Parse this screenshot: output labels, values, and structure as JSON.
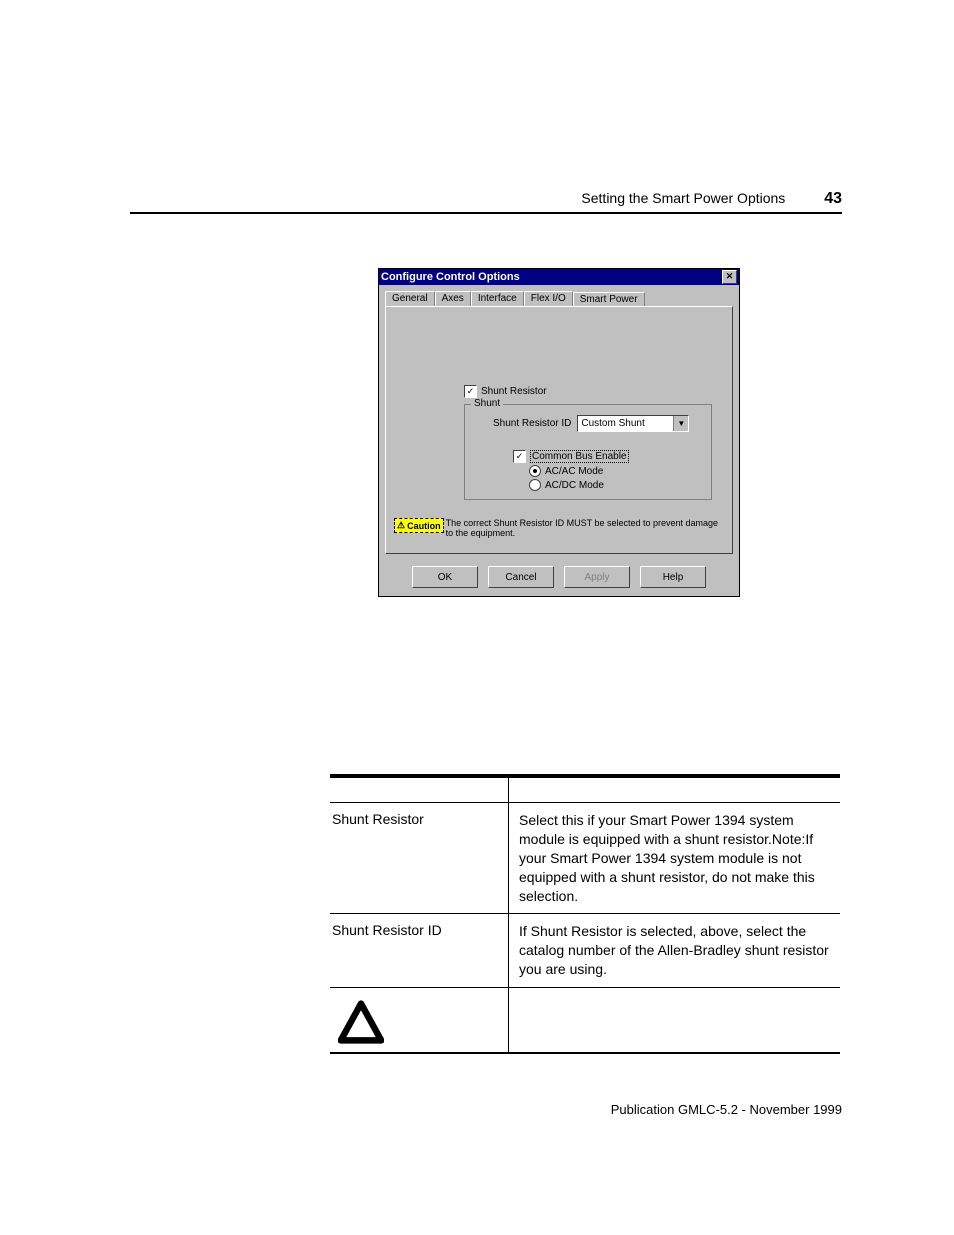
{
  "header": {
    "title": "Setting the Smart Power Options",
    "page_number": "43"
  },
  "footer": "Publication GMLC-5.2 - November 1999",
  "dialog": {
    "title": "Configure Control Options",
    "close_glyph": "✕",
    "tabs": {
      "general": "General",
      "axes": "Axes",
      "interface": "Interface",
      "flexio": "Flex I/O",
      "smart_power": "Smart Power"
    },
    "shunt_resistor_label": "Shunt Resistor",
    "shunt_group_label": "Shunt",
    "shunt_id_label": "Shunt Resistor ID",
    "shunt_id_value": "Custom Shunt",
    "common_bus_label": "Common Bus Enable",
    "acac_label": "AC/AC Mode",
    "acdc_label": "AC/DC Mode",
    "caution_badge": "Caution",
    "caution_text": "The correct Shunt Resistor ID MUST be selected to prevent damage to the equipment.",
    "buttons": {
      "ok": "OK",
      "cancel": "Cancel",
      "apply": "Apply",
      "help": "Help"
    }
  },
  "table": {
    "rows": [
      {
        "field": "Shunt Resistor",
        "desc": "Select this if your Smart Power 1394 system module is equipped with a shunt resistor.Note:If your Smart Power 1394 system module is not equipped with a shunt resistor, do not make this selection."
      },
      {
        "field": "Shunt Resistor ID",
        "desc": "If Shunt Resistor is selected, above, select the catalog number of the Allen-Bradley shunt resistor you are using."
      }
    ]
  }
}
